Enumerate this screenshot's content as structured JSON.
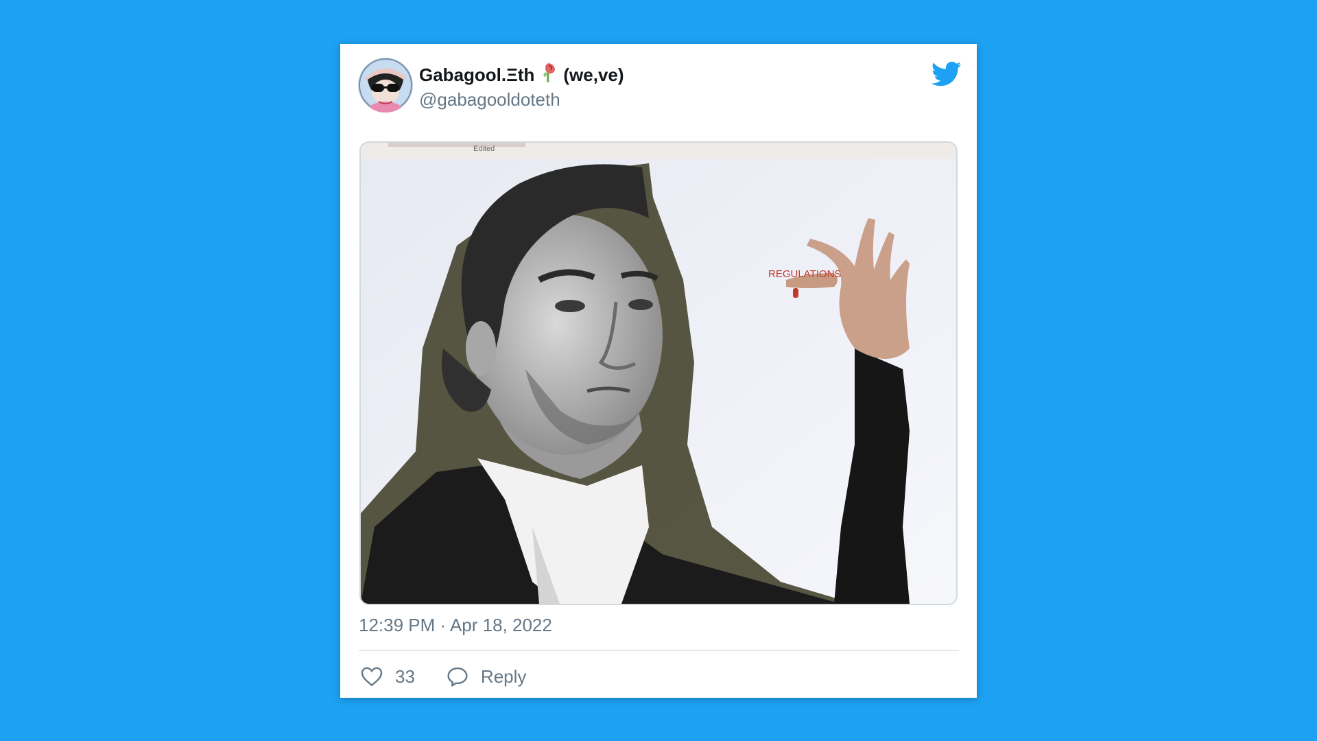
{
  "tweet": {
    "display_name": "Gabagool.Ξth",
    "pronouns": "(we,ve)",
    "handle": "@gabagooldoteth",
    "timestamp": "12:39 PM · Apr 18, 2022",
    "image_caption": "REGULATIONS",
    "image_top_label": "Edited",
    "like_count": "33",
    "reply_label": "Reply"
  },
  "icons": {
    "brand": "twitter-bird-icon",
    "like": "heart-icon",
    "reply": "speech-bubble-icon",
    "name_emoji": "rose-emoji-icon"
  },
  "colors": {
    "background": "#1da1f2",
    "card": "#ffffff",
    "name": "#14171a",
    "secondary_text": "#657786",
    "twitter_blue": "#1da1f2",
    "caption_red": "#c0392b"
  }
}
